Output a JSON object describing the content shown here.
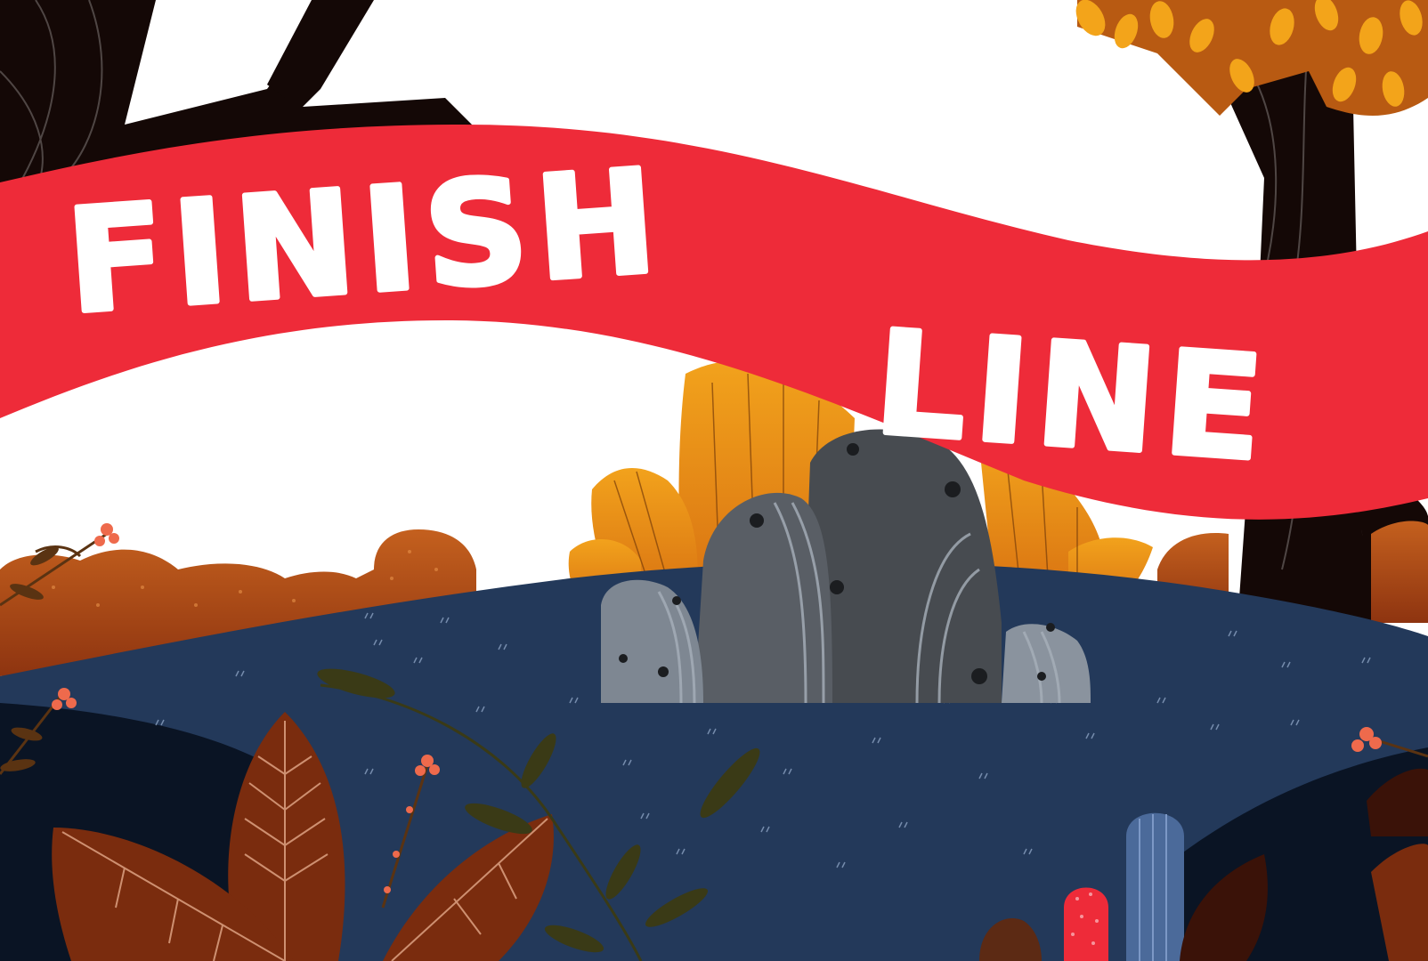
{
  "banner": {
    "word_1": "FINISH",
    "word_2": "LINE"
  },
  "colors": {
    "background": "#ffffff",
    "banner_red": "#ee2b39",
    "banner_text": "#ffffff",
    "ground_dark": "#23395a",
    "ground_shadow": "#0a1424",
    "tree_trunk": "#140806",
    "rock_dark": "#474b50",
    "rock_light": "#7e8792",
    "foliage_orange": "#e89218",
    "foliage_rust": "#b75018",
    "leaf_brown": "#7a2c0e",
    "berry": "#ee6a4c"
  },
  "icons": [
    "tree-icon",
    "bush-icon",
    "rock-icon",
    "leaf-plant-icon",
    "berry-branch-icon",
    "cactus-icon"
  ]
}
